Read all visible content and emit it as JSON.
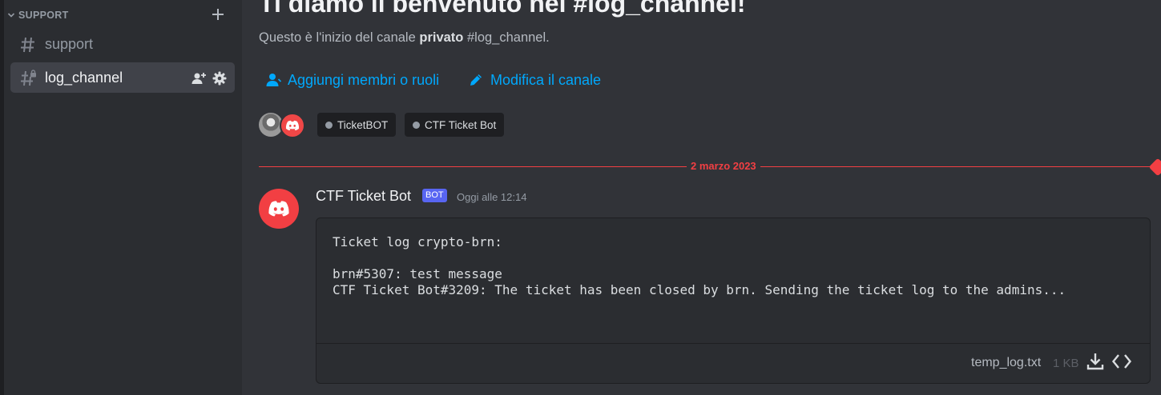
{
  "sidebar": {
    "category_label": "SUPPORT",
    "channels": [
      {
        "name": "support",
        "active": false
      },
      {
        "name": "log_channel",
        "active": true
      }
    ]
  },
  "welcome": {
    "title": "Ti diamo il benvenuto nel #log_channel!",
    "subtitle_prefix": "Questo è l'inizio del canale",
    "subtitle_bold": "privato",
    "subtitle_suffix": "#log_channel.",
    "actions": {
      "add_members": "Aggiungi membri o ruoli",
      "edit_channel": "Modifica il canale"
    },
    "members": [
      "TicketBOT",
      "CTF Ticket Bot"
    ]
  },
  "divider": {
    "date": "2 marzo 2023"
  },
  "message": {
    "author": "CTF Ticket Bot",
    "bot_tag": "BOT",
    "timestamp": "Oggi alle 12:14",
    "attachment": {
      "content": "Ticket log crypto-brn:\n\nbrn#5307: test message\nCTF Ticket Bot#3209: The ticket has been closed by brn. Sending the ticket log to the admins...",
      "file_name": "temp_log.txt",
      "file_size": "1 KB"
    }
  },
  "colors": {
    "accent_link": "#00a8fc",
    "new_divider": "#f23f43",
    "bot_tag": "#5865f2",
    "bot_avatar": "#f23f43"
  },
  "icons": {
    "category": "chevron-down-icon",
    "add_channel": "plus-icon",
    "channel": "hash-icon",
    "private_channel": "hash-lock-icon",
    "invite": "add-member-icon",
    "settings": "gear-icon",
    "add_members": "person-icon",
    "edit_channel": "pencil-icon",
    "bot_avatar": "discord-logo-icon",
    "download": "download-icon",
    "view_code": "code-icon"
  }
}
